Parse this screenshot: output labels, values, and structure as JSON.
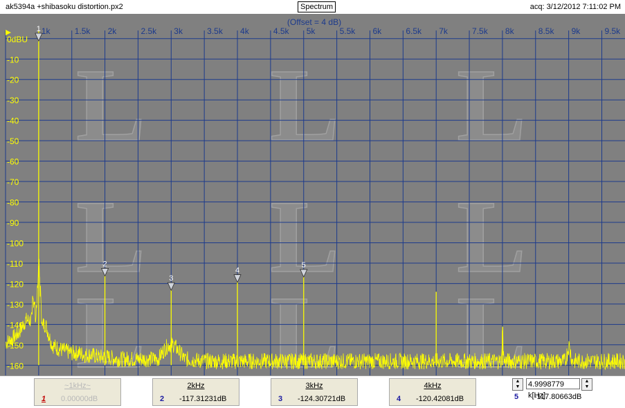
{
  "window": {
    "file_title": "ak5394a +shibasoku distortion.px2",
    "view_label": "Spectrum",
    "acq_label": "acq: 3/12/2012 7:11:02 PM"
  },
  "plot": {
    "offset_label": "(Offset = 4 dB)",
    "x_tick_labels": [
      "1k",
      "1.5k",
      "2k",
      "2.5k",
      "3k",
      "3.5k",
      "4k",
      "4.5k",
      "5k",
      "5.5k",
      "6k",
      "6.5k",
      "7k",
      "7.5k",
      "8k",
      "8.5k",
      "9k",
      "9.5k"
    ],
    "y_tick_labels": [
      "0dBU",
      "-10",
      "-20",
      "-30",
      "-40",
      "-50",
      "-60",
      "-70",
      "-80",
      "-90",
      "-100",
      "-110",
      "-120",
      "-130",
      "-140",
      "-150",
      "-160"
    ],
    "colors": {
      "background": "#808080",
      "grid": "#1c3a8c",
      "trace": "#ffff00",
      "axis_text": "#ffff00",
      "marker_fill": "#d0d4dc"
    }
  },
  "chart_data": {
    "type": "line",
    "xlabel": "",
    "ylabel": "",
    "xlim": [
      500,
      9850
    ],
    "ylim": [
      -165,
      4
    ],
    "x_unit": "Hz",
    "y_unit": "dBU",
    "grid": true,
    "series": [
      {
        "x": [
          500,
          600,
          700,
          800,
          900,
          950,
          980,
          1000,
          1020,
          1050,
          1100,
          1200,
          1300,
          1400,
          1500,
          1600,
          1700,
          1800,
          1900,
          1980,
          2000,
          2020,
          2200,
          2500,
          2800,
          2900,
          2960,
          3000,
          3040,
          3200,
          3500,
          3800,
          3990,
          4000,
          4010,
          4200,
          4500,
          4900,
          4990,
          5000,
          5010,
          5200,
          5500,
          6000,
          6500,
          6980,
          7000,
          7020,
          7500,
          7980,
          8000,
          8020,
          8500,
          8950,
          9000,
          9050,
          9500,
          9850
        ],
        "y": [
          -149,
          -147,
          -144,
          -138,
          -128,
          -120,
          -110,
          4,
          -110,
          -124,
          -140,
          -150,
          -152,
          -153,
          -154,
          -154,
          -155,
          -155,
          -156,
          -156,
          -114,
          -156,
          -157,
          -157,
          -157,
          -152,
          -150,
          -121,
          -150,
          -157,
          -158,
          -158,
          -158,
          -116,
          -158,
          -158,
          -158,
          -158,
          -158,
          -114,
          -158,
          -158,
          -158,
          -158,
          -158,
          -158,
          -124,
          -158,
          -158,
          -158,
          -143,
          -158,
          -158,
          -158,
          -150,
          -158,
          -158,
          -158
        ]
      }
    ],
    "markers": [
      {
        "label": "1",
        "x": 1000,
        "y": 0
      },
      {
        "label": "2",
        "x": 2000,
        "y": -117.3
      },
      {
        "label": "3",
        "x": 3000,
        "y": -124.3
      },
      {
        "label": "4",
        "x": 4000,
        "y": -120.4
      },
      {
        "label": "5",
        "x": 5000,
        "y": -117.8
      }
    ]
  },
  "markers_panel": [
    {
      "freq": "~1kHz~",
      "num": "1",
      "value": "0.00000dB"
    },
    {
      "freq": "2kHz",
      "num": "2",
      "value": "-117.31231dB"
    },
    {
      "freq": "3kHz",
      "num": "3",
      "value": "-124.30721dB"
    },
    {
      "freq": "4kHz",
      "num": "4",
      "value": "-120.42081dB"
    }
  ],
  "marker5": {
    "num": "5",
    "freq_value": "4.9998779 k[Hz]",
    "value": "-117.80663dB"
  }
}
